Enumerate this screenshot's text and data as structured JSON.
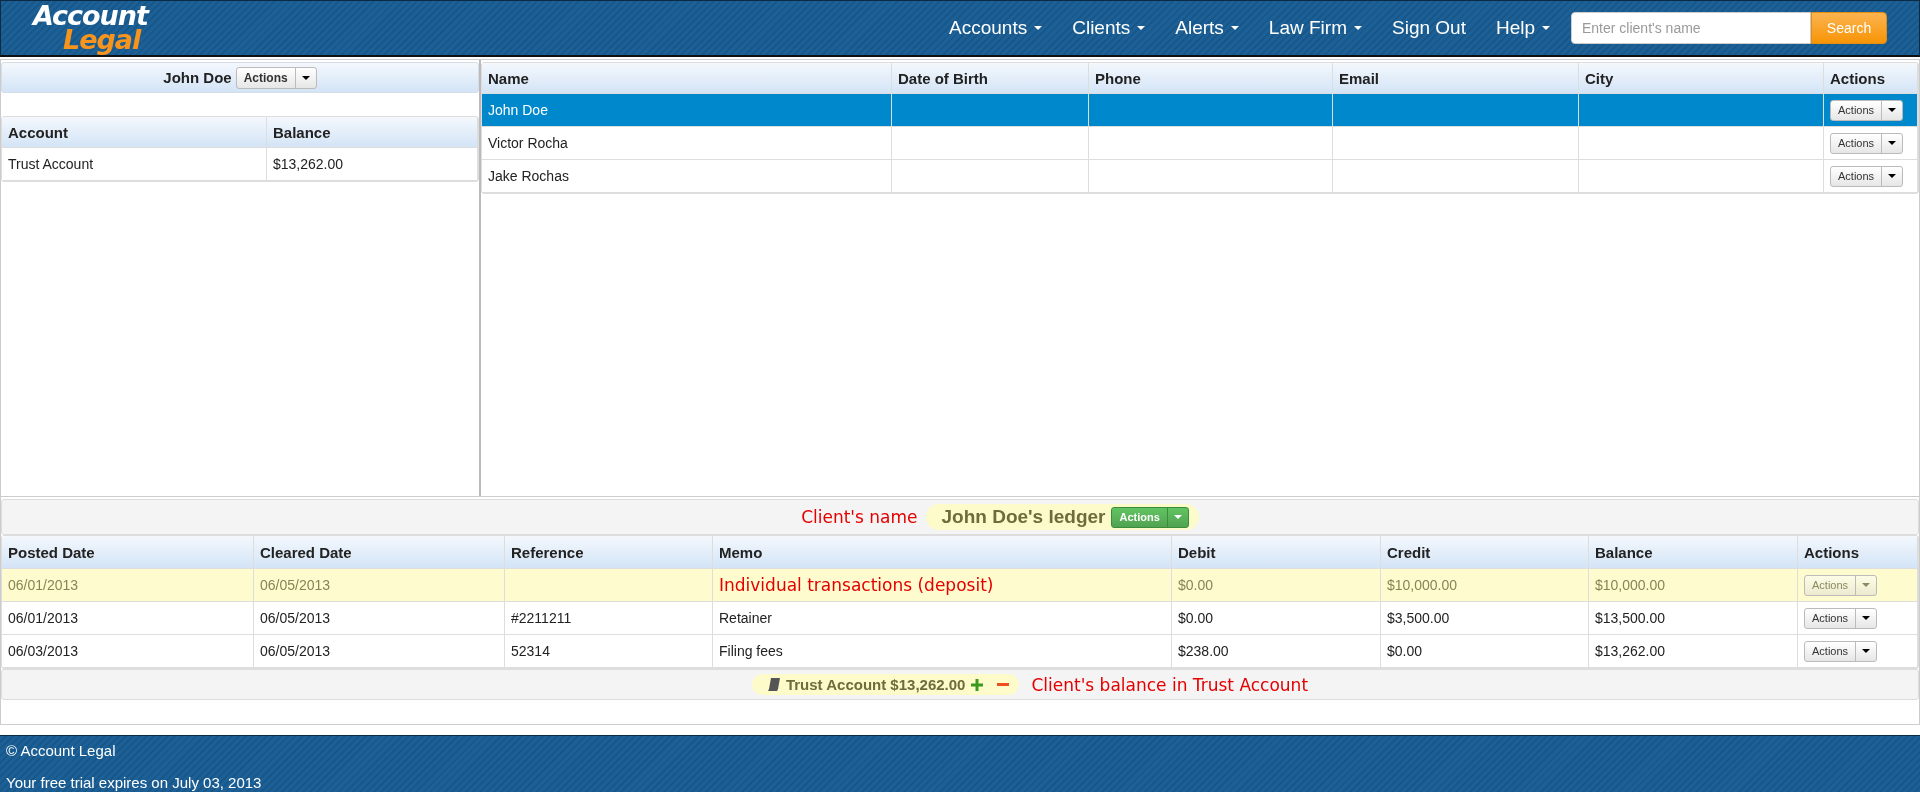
{
  "brand": {
    "line_1": "Account",
    "line_2": "Legal"
  },
  "nav": [
    {
      "label": "Accounts",
      "dropdown": true
    },
    {
      "label": "Clients",
      "dropdown": true
    },
    {
      "label": "Alerts",
      "dropdown": true
    },
    {
      "label": "Law Firm",
      "dropdown": true
    },
    {
      "label": "Sign Out",
      "dropdown": false
    },
    {
      "label": "Help",
      "dropdown": true
    }
  ],
  "search": {
    "placeholder": "Enter client's name",
    "button": "Search"
  },
  "client_panel": {
    "name": "John Doe",
    "actions": "Actions",
    "columns": [
      "Account",
      "Balance"
    ],
    "rows": [
      [
        "Trust Account",
        "$13,262.00"
      ]
    ]
  },
  "clients_table": {
    "columns": [
      "Name",
      "Date of Birth",
      "Phone",
      "Email",
      "City",
      "Actions"
    ],
    "rows": [
      {
        "name": "John Doe",
        "selected": true,
        "actions": "Actions"
      },
      {
        "name": "Victor Rocha",
        "selected": false,
        "actions": "Actions"
      },
      {
        "name": "Jake Rochas",
        "selected": false,
        "actions": "Actions"
      }
    ]
  },
  "ledger": {
    "annotation": "Client's name",
    "title": "John Doe's ledger",
    "actions": "Actions",
    "columns": [
      "Posted Date",
      "Cleared Date",
      "Reference",
      "Memo",
      "Debit",
      "Credit",
      "Balance",
      "Actions"
    ],
    "rows": [
      {
        "posted_date": "06/01/2013",
        "cleared_date": "06/05/2013",
        "annotation": "Individual transactions (deposit)",
        "debit": "$0.00",
        "credit": "$10,000.00",
        "balance": "$10,000.00",
        "highlighted": true,
        "actions": "Actions"
      },
      {
        "posted_date": "06/01/2013",
        "cleared_date": "06/05/2013",
        "reference": "#2211211",
        "memo": "Retainer",
        "debit": "$0.00",
        "credit": "$3,500.00",
        "balance": "$13,500.00",
        "highlighted": false,
        "actions": "Actions"
      },
      {
        "posted_date": "06/03/2013",
        "cleared_date": "06/05/2013",
        "reference": "52314",
        "memo": "Filing fees",
        "debit": "$238.00",
        "credit": "$0.00",
        "balance": "$13,262.00",
        "highlighted": false,
        "actions": "Actions"
      }
    ],
    "summary": {
      "text": "Trust Account $13,262.00",
      "annotation": "Client's balance in Trust Account"
    }
  },
  "footer": {
    "copyright": "© Account Legal",
    "trial": "Your free trial expires on July 03, 2013"
  }
}
